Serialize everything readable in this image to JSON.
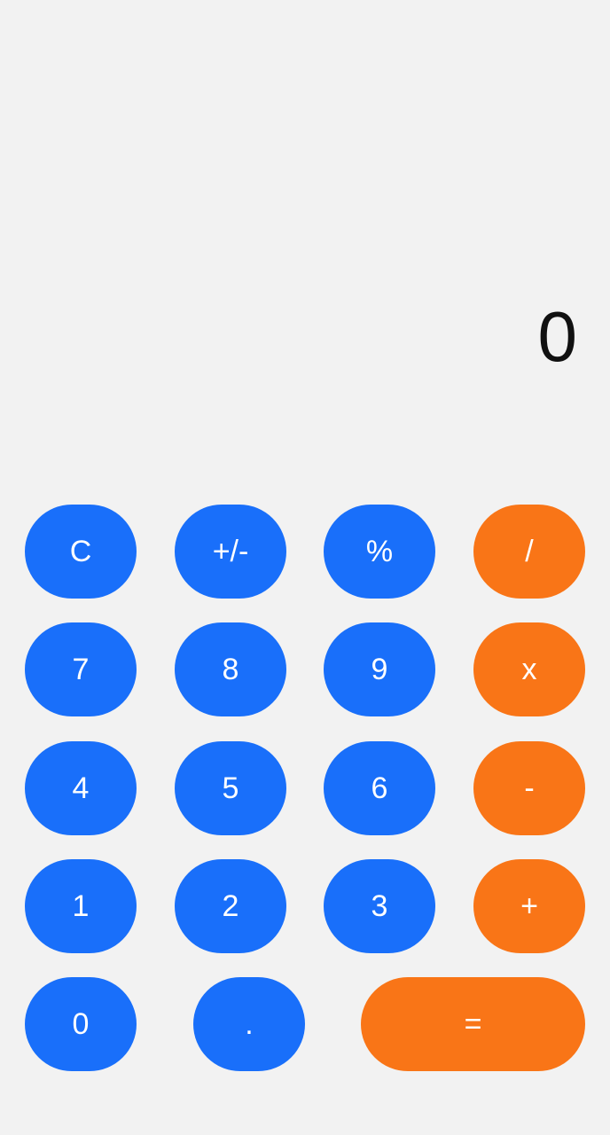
{
  "display": {
    "value": "0"
  },
  "keys": {
    "clear": "C",
    "toggle_sign": "+/-",
    "percent": "%",
    "divide": "/",
    "seven": "7",
    "eight": "8",
    "nine": "9",
    "multiply": "x",
    "four": "4",
    "five": "5",
    "six": "6",
    "subtract": "-",
    "one": "1",
    "two": "2",
    "three": "3",
    "add": "+",
    "zero": "0",
    "decimal": ".",
    "equals": "="
  },
  "colors": {
    "number_key": "#196ffa",
    "operator_key": "#f97517",
    "background": "#f2f2f2",
    "display_text": "#111111"
  }
}
